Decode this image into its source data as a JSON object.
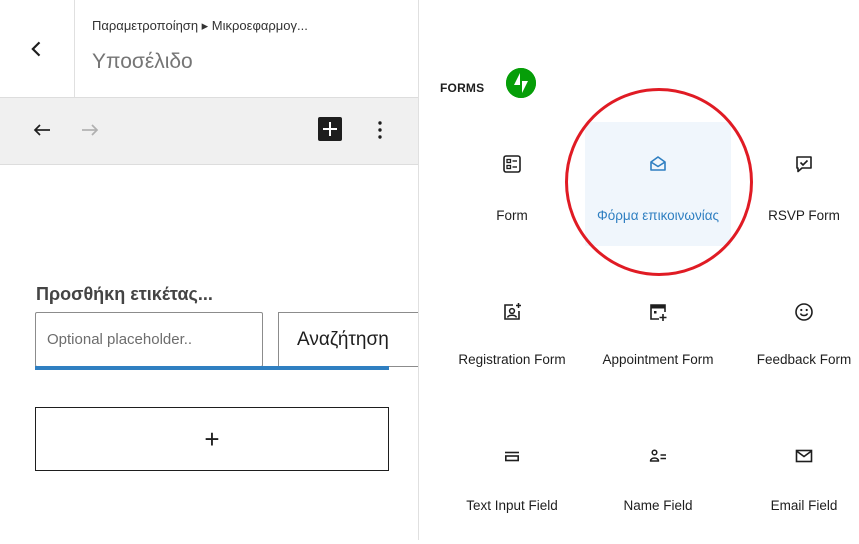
{
  "header": {
    "breadcrumb": "Παραμετροποίηση ▸ Μικροεφαρμογ...",
    "title": "Υποσέλιδο"
  },
  "toolbar": {
    "undo_icon": "undo-icon",
    "redo_icon": "redo-icon",
    "add_icon": "plus-icon",
    "more_icon": "more-vertical-icon"
  },
  "search_block": {
    "label": "Προσθήκη ετικέτας...",
    "placeholder": "Optional placeholder..",
    "button_label": "Αναζήτηση"
  },
  "appender": {
    "label": "+"
  },
  "inserter": {
    "category": "FORMS",
    "category_icon": "jetpack-logo-icon",
    "blocks": [
      {
        "label": "Form",
        "icon": "form-icon",
        "selected": false
      },
      {
        "label": "Φόρμα επικοινωνίας",
        "icon": "envelope-open-icon",
        "selected": true
      },
      {
        "label": "RSVP Form",
        "icon": "rsvp-check-icon",
        "selected": false
      },
      {
        "label": "Registration Form",
        "icon": "registration-icon",
        "selected": false
      },
      {
        "label": "Appointment Form",
        "icon": "calendar-plus-icon",
        "selected": false
      },
      {
        "label": "Feedback Form",
        "icon": "smiley-icon",
        "selected": false
      },
      {
        "label": "Text Input Field",
        "icon": "text-input-icon",
        "selected": false
      },
      {
        "label": "Name Field",
        "icon": "name-field-icon",
        "selected": false
      },
      {
        "label": "Email Field",
        "icon": "envelope-icon",
        "selected": false
      }
    ]
  },
  "colors": {
    "accent": "#2f7fc1",
    "selected_bg": "#f0f6fc",
    "annotation": "#e01b24",
    "jetpack_green": "#069e08"
  }
}
